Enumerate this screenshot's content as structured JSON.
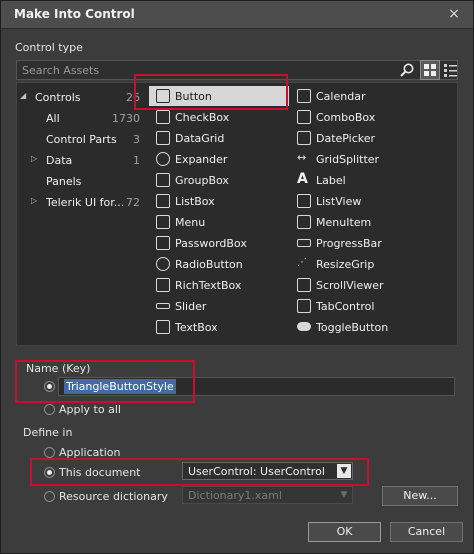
{
  "window": {
    "title": "Make Into Control",
    "close_icon": "×"
  },
  "control_type": {
    "heading": "Control type",
    "search_placeholder": "Search Assets"
  },
  "tree": [
    {
      "label": "Controls",
      "count": "26",
      "expander": "◢"
    },
    {
      "label": "All",
      "count": "1730",
      "expander": ""
    },
    {
      "label": "Control Parts",
      "count": "3",
      "expander": ""
    },
    {
      "label": "Data",
      "count": "1",
      "expander": "▷"
    },
    {
      "label": "Panels",
      "count": "",
      "expander": ""
    },
    {
      "label": "Telerik UI for...",
      "count": "72",
      "expander": "▷"
    }
  ],
  "controls": [
    {
      "label": "Button",
      "icon": "button-icon"
    },
    {
      "label": "Calendar",
      "icon": "calendar-icon"
    },
    {
      "label": "CheckBox",
      "icon": "checkbox-icon"
    },
    {
      "label": "ComboBox",
      "icon": "combobox-icon"
    },
    {
      "label": "DataGrid",
      "icon": "datagrid-icon"
    },
    {
      "label": "DatePicker",
      "icon": "datepicker-icon"
    },
    {
      "label": "Expander",
      "icon": "expander-icon"
    },
    {
      "label": "GridSplitter",
      "icon": "gridsplitter-icon"
    },
    {
      "label": "GroupBox",
      "icon": "groupbox-icon"
    },
    {
      "label": "Label",
      "icon": "label-icon"
    },
    {
      "label": "ListBox",
      "icon": "listbox-icon"
    },
    {
      "label": "ListView",
      "icon": "listview-icon"
    },
    {
      "label": "Menu",
      "icon": "menu-icon"
    },
    {
      "label": "MenuItem",
      "icon": "menuitem-icon"
    },
    {
      "label": "PasswordBox",
      "icon": "passwordbox-icon"
    },
    {
      "label": "ProgressBar",
      "icon": "progressbar-icon"
    },
    {
      "label": "RadioButton",
      "icon": "radiobutton-icon"
    },
    {
      "label": "ResizeGrip",
      "icon": "resizegrip-icon"
    },
    {
      "label": "RichTextBox",
      "icon": "richtextbox-icon"
    },
    {
      "label": "ScrollViewer",
      "icon": "scrollviewer-icon"
    },
    {
      "label": "Slider",
      "icon": "slider-icon"
    },
    {
      "label": "TabControl",
      "icon": "tabcontrol-icon"
    },
    {
      "label": "TextBox",
      "icon": "textbox-icon"
    },
    {
      "label": "ToggleButton",
      "icon": "togglebutton-icon"
    }
  ],
  "name_section": {
    "heading": "Name (Key)",
    "value": "TriangleButtonStyle",
    "apply_to_all": "Apply to all"
  },
  "define_in": {
    "heading": "Define in",
    "application": "Application",
    "this_document": "This document",
    "resource_dictionary": "Resource dictionary",
    "document_target": "UserControl: UserControl",
    "dictionary_file": "Dictionary1.xaml",
    "new_button": "New..."
  },
  "buttons": {
    "ok": "OK",
    "cancel": "Cancel"
  },
  "colors": {
    "background": "#3c3c3c",
    "panel": "#2b2b2b",
    "selection": "#d7d7d7",
    "text_selection": "#3d6ca9",
    "highlight_box": "#c8102e"
  }
}
